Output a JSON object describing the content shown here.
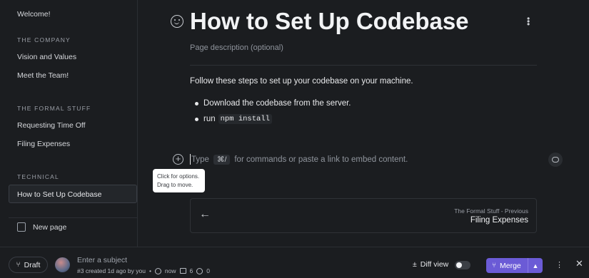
{
  "sidebar": {
    "welcome": "Welcome!",
    "section_company": "THE COMPANY",
    "company_items": [
      "Vision and Values",
      "Meet the Team!"
    ],
    "section_formal": "THE FORMAL STUFF",
    "formal_items": [
      "Requesting Time Off",
      "Filing Expenses"
    ],
    "section_technical": "TECHNICAL",
    "technical_items": [
      "How to Set Up Codebase"
    ],
    "new_page": "New page"
  },
  "page": {
    "title": "How to Set Up Codebase",
    "description_placeholder": "Page description (optional)",
    "paragraph": "Follow these steps to set up your codebase on your machine.",
    "bullet1": "Download the codebase from the server.",
    "bullet2_prefix": "run",
    "bullet2_code": "npm install",
    "input_prefix": "Type",
    "input_kbd": "⌘/",
    "input_suffix": "for commands or paste a link to embed content.",
    "tooltip_line1": "Click for options.",
    "tooltip_line2": "Drag to move."
  },
  "nav": {
    "label": "The Formal Stuff - Previous",
    "title": "Filing Expenses"
  },
  "footer": {
    "draft": "Draft",
    "subject_placeholder": "Enter a subject",
    "meta_created": "#3 created 1d ago by you",
    "meta_time": "now",
    "meta_count": "6",
    "meta_comments": "0",
    "diff_view": "Diff view",
    "merge": "Merge"
  },
  "colors": {
    "background": "#1b1d20",
    "accent": "#6b5bd6"
  }
}
